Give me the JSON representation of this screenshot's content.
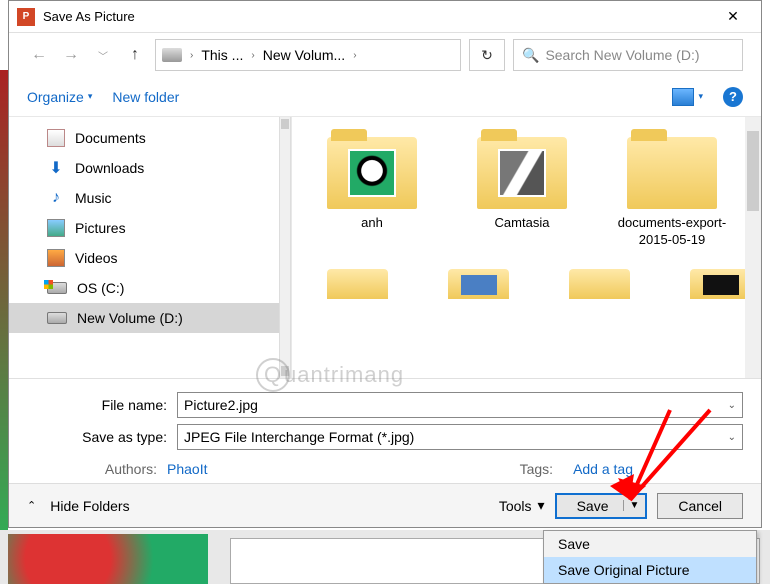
{
  "window": {
    "app_icon_text": "P",
    "title": "Save As Picture",
    "close": "✕"
  },
  "nav": {
    "back": "←",
    "forward": "→",
    "recent_caret": "﹀",
    "up": "↑",
    "refresh": "↻"
  },
  "breadcrumb": {
    "seg1": "This ...",
    "seg2": "New Volum...",
    "sep": "›"
  },
  "search": {
    "icon": "🔍",
    "placeholder": "Search New Volume (D:)"
  },
  "toolbar": {
    "organize": "Organize",
    "organize_caret": "▾",
    "new_folder": "New folder",
    "view_caret": "▾",
    "help": "?"
  },
  "tree": {
    "items": [
      {
        "label": "Documents",
        "icon": "doc"
      },
      {
        "label": "Downloads",
        "icon": "down"
      },
      {
        "label": "Music",
        "icon": "music"
      },
      {
        "label": "Pictures",
        "icon": "pic"
      },
      {
        "label": "Videos",
        "icon": "vid"
      },
      {
        "label": "OS (C:)",
        "icon": "os"
      },
      {
        "label": "New Volume (D:)",
        "icon": "drive",
        "selected": true
      }
    ]
  },
  "content": {
    "folders": [
      {
        "label": "anh",
        "thumb": "panda"
      },
      {
        "label": "Camtasia",
        "thumb": "cam"
      },
      {
        "label": "documents-export-2015-05-19",
        "thumb": ""
      }
    ]
  },
  "form": {
    "filename_label": "File name:",
    "filename_value": "Picture2.jpg",
    "savetype_label": "Save as type:",
    "savetype_value": "JPEG File Interchange Format (*.jpg)",
    "authors_label": "Authors:",
    "authors_value": "PhaoIt",
    "tags_label": "Tags:",
    "tags_value": "Add a tag"
  },
  "footer": {
    "hide_caret": "⌃",
    "hide_folders": "Hide Folders",
    "tools": "Tools",
    "tools_caret": "▾",
    "save": "Save",
    "save_caret": "▼",
    "cancel": "Cancel"
  },
  "save_menu": {
    "item1": "Save",
    "item2": "Save Original Picture"
  },
  "watermark": {
    "q": "Q",
    "text": "uantrimang"
  }
}
